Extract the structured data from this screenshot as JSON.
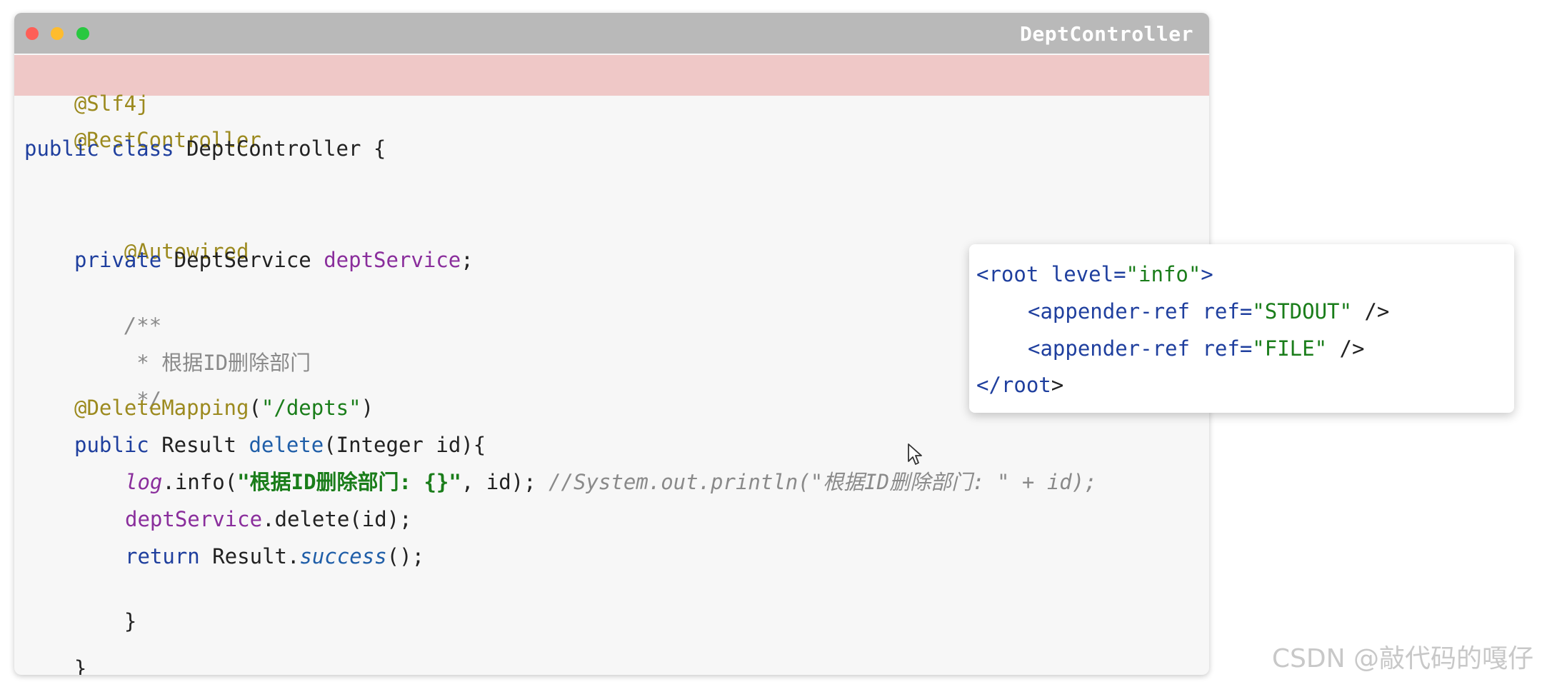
{
  "window": {
    "title": "DeptController",
    "controls": [
      "close-dot",
      "minimize-dot",
      "maximize-dot"
    ],
    "highlight_color": "#efc8c7"
  },
  "code": {
    "l1": "@Slf4j",
    "l2": "@RestController",
    "l3_kw": "public class",
    "l3_rest": " DeptController {",
    "l5": "@Autowired",
    "l6_kw": "private",
    "l6_type": " DeptService ",
    "l6_field": "deptService",
    "l6_end": ";",
    "l7": "/**",
    "l8": " * 根据ID删除部门",
    "l9": " */",
    "l10_ann": "@DeleteMapping",
    "l10_open": "(",
    "l10_str": "\"/depts\"",
    "l10_close": ")",
    "l11_kw": "public",
    "l11_type": " Result ",
    "l11_method": "delete",
    "l11_rest": "(Integer id){",
    "l12_log": "log",
    "l12_call": ".info(",
    "l12_str": "\"根据ID删除部门: {}\"",
    "l12_rest": ", id); ",
    "l12_comment": "//System.out.println(\"根据ID删除部门: \" + id);",
    "l13_field": "deptService",
    "l13_rest": ".delete(id);",
    "l14_kw": "return",
    "l14_type": " Result.",
    "l14_static": "success",
    "l14_end": "();",
    "l15": "}",
    "l16": "}"
  },
  "popup": {
    "l1_open": "<root ",
    "l1_attr": "level=",
    "l1_val": "\"info\"",
    "l1_close": ">",
    "l2_open": "<appender-ref ",
    "l2_attr": "ref=",
    "l2_val": "\"STDOUT\"",
    "l2_close": " />",
    "l3_open": "<appender-ref ",
    "l3_attr": "ref=",
    "l3_val": "\"FILE\"",
    "l3_close": " />",
    "l4_tag": "</root",
    "l4_close": ">"
  },
  "watermark": "CSDN @敲代码的嘎仔"
}
